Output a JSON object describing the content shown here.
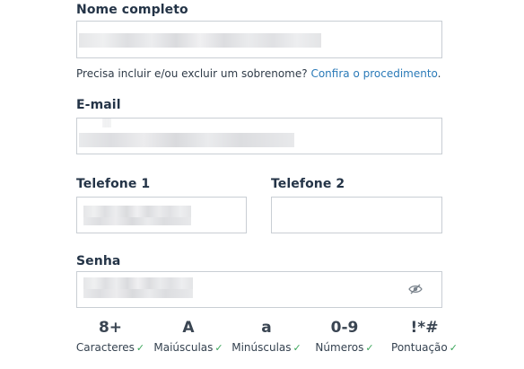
{
  "name": {
    "label": "Nome completo",
    "hint_text": "Precisa incluir e/ou excluir um sobrenome?",
    "hint_link": "Confira o procedimento",
    "hint_end": "."
  },
  "email": {
    "label": "E-mail"
  },
  "phone1": {
    "label": "Telefone 1"
  },
  "phone2": {
    "label": "Telefone 2"
  },
  "password": {
    "label": "Senha",
    "toggle_icon": "eye-slash-icon"
  },
  "requirements": [
    {
      "symbol": "8+",
      "label": "Caracteres",
      "check": "✓"
    },
    {
      "symbol": "A",
      "label": "Maiúsculas",
      "check": "✓"
    },
    {
      "symbol": "a",
      "label": "Minúsculas",
      "check": "✓"
    },
    {
      "symbol": "0-9",
      "label": "Números",
      "check": "✓"
    },
    {
      "symbol": "!*#",
      "label": "Pontuação",
      "check": "✓"
    }
  ],
  "colors": {
    "link": "#2a7ab8",
    "check": "#3aa65a",
    "border": "#c9ced4"
  }
}
